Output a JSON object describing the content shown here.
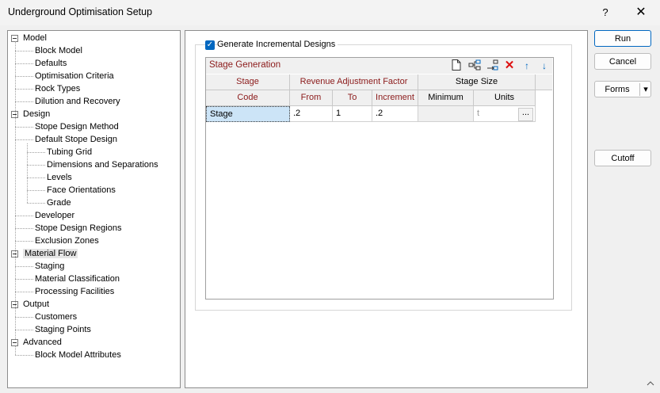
{
  "window": {
    "title": "Underground Optimisation Setup",
    "help": "?",
    "close": "✕"
  },
  "tree": {
    "items": [
      {
        "label": "Model",
        "level": 0
      },
      {
        "label": "Block Model",
        "level": 1
      },
      {
        "label": "Defaults",
        "level": 1
      },
      {
        "label": "Optimisation Criteria",
        "level": 1
      },
      {
        "label": "Rock Types",
        "level": 1
      },
      {
        "label": "Dilution and Recovery",
        "level": 1
      },
      {
        "label": "Design",
        "level": 0
      },
      {
        "label": "Stope Design Method",
        "level": 1
      },
      {
        "label": "Default Stope Design",
        "level": 1
      },
      {
        "label": "Tubing Grid",
        "level": 2
      },
      {
        "label": "Dimensions and Separations",
        "level": 2
      },
      {
        "label": "Levels",
        "level": 2
      },
      {
        "label": "Face Orientations",
        "level": 2
      },
      {
        "label": "Grade",
        "level": 2
      },
      {
        "label": "Developer",
        "level": 1
      },
      {
        "label": "Stope Design Regions",
        "level": 1
      },
      {
        "label": "Exclusion Zones",
        "level": 1
      },
      {
        "label": "Material Flow",
        "level": 0,
        "selected": true
      },
      {
        "label": "Staging",
        "level": 1
      },
      {
        "label": "Material Classification",
        "level": 1
      },
      {
        "label": "Processing Facilities",
        "level": 1
      },
      {
        "label": "Output",
        "level": 0
      },
      {
        "label": "Customers",
        "level": 1
      },
      {
        "label": "Staging Points",
        "level": 1
      },
      {
        "label": "Advanced",
        "level": 0
      },
      {
        "label": "Block Model Attributes",
        "level": 1
      }
    ]
  },
  "main": {
    "generate_label": "Generate Incremental Designs",
    "generate_checked": true,
    "grid": {
      "title": "Stage Generation",
      "header_row1": {
        "stage": "Stage",
        "raf": "Revenue Adjustment Factor",
        "size": "Stage Size"
      },
      "header_row2": {
        "code": "Code",
        "from": "From",
        "to": "To",
        "increment": "Increment",
        "minimum": "Minimum",
        "units": "Units"
      },
      "rows": [
        {
          "code": "Stage",
          "from": ".2",
          "to": "1",
          "increment": ".2",
          "minimum": "",
          "units": "t",
          "ellipsis": "..."
        }
      ]
    }
  },
  "buttons": {
    "run": "Run",
    "cancel": "Cancel",
    "forms": "Forms",
    "forms_arrow": "▾",
    "cutoff": "Cutoff"
  }
}
